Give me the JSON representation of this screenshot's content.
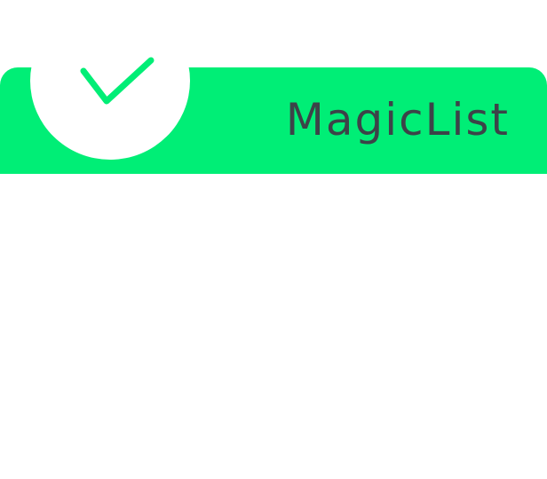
{
  "app": {
    "title": "MagicList"
  },
  "logo": {
    "icon": "checkmark-icon"
  },
  "colors": {
    "accent": "#00ee76",
    "title_text": "#3c4348",
    "background": "#ffffff"
  }
}
